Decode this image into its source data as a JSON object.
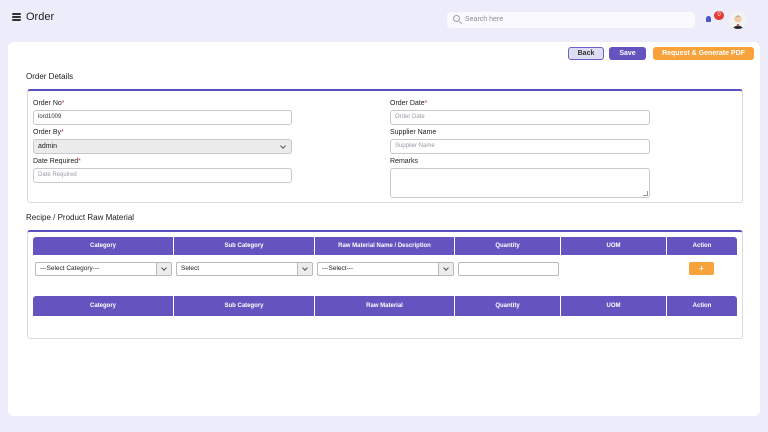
{
  "header": {
    "title": "Order",
    "search_placeholder": "Search here",
    "notification_count": "0"
  },
  "toolbar": {
    "back_label": "Back",
    "save_label": "Save",
    "pdf_label": "Request & Generate PDF"
  },
  "order_details": {
    "section_title": "Order Details",
    "order_no": {
      "label": "Order No",
      "value": "lord1009"
    },
    "order_by": {
      "label": "Order By",
      "value": "admin"
    },
    "date_required": {
      "label": "Date Required",
      "placeholder": "Date Required"
    },
    "order_date": {
      "label": "Order Date",
      "placeholder": "Order Date"
    },
    "supplier_name": {
      "label": "Supplier Name",
      "placeholder": "Supplier Name"
    },
    "remarks": {
      "label": "Remarks"
    },
    "required_mark": "*"
  },
  "raw_material": {
    "section_title": "Recipe / Product Raw Material",
    "entry_headers": [
      "Category",
      "Sub Category",
      "Raw Material Name / Description",
      "Quantity",
      "UOM",
      "Action"
    ],
    "category_select": "---Select Category---",
    "subcategory_select": "Select",
    "material_select": "---Select---",
    "add_label": "+",
    "list_headers": [
      "Category",
      "Sub Category",
      "Raw Material",
      "Quantity",
      "UOM",
      "Action"
    ]
  },
  "colors": {
    "accent": "#6554c0",
    "orange": "#f7a23b",
    "badge": "#e53935"
  }
}
